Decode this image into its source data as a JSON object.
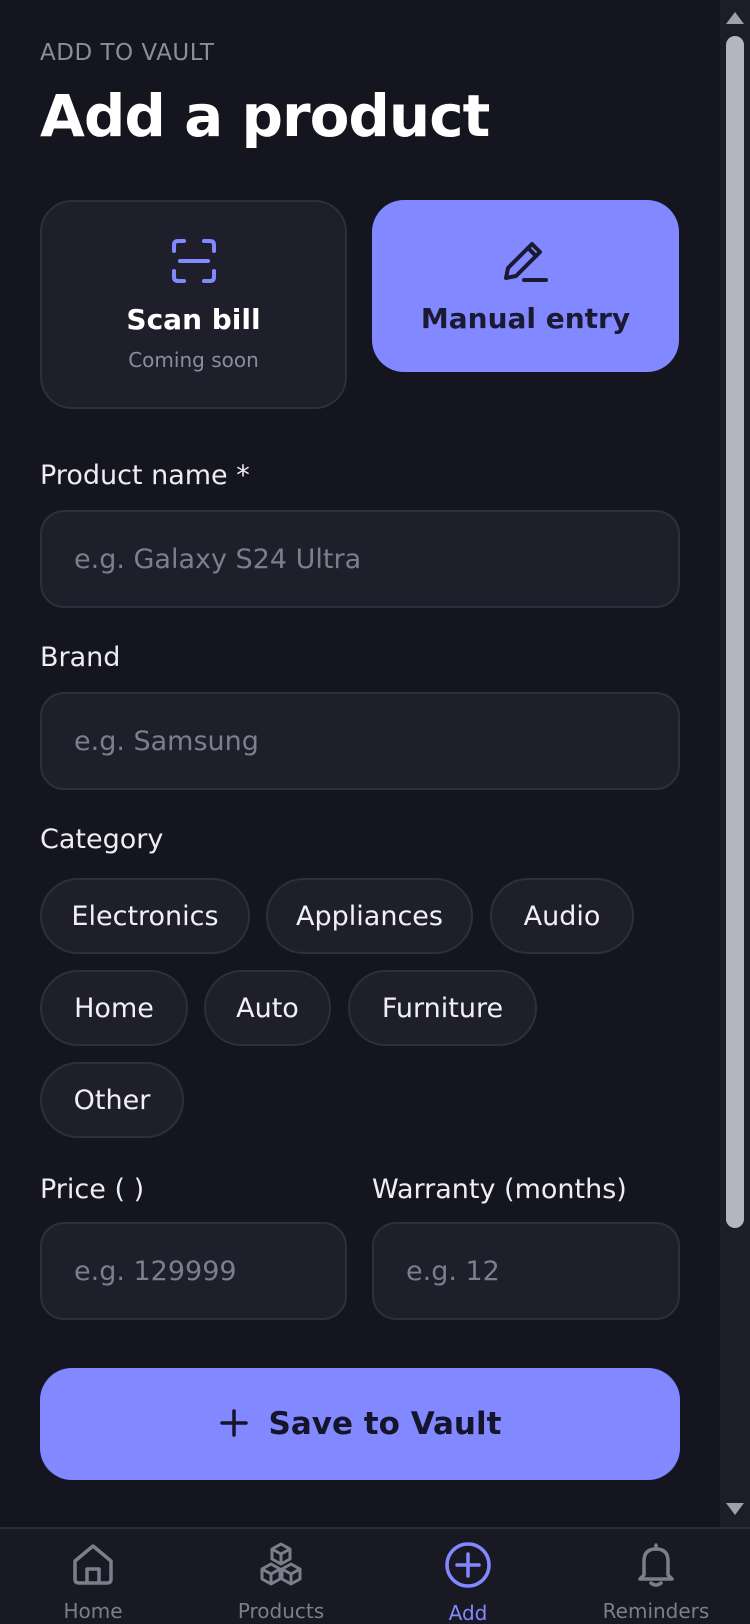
{
  "header": {
    "eyebrow": "ADD TO VAULT",
    "title": "Add a product"
  },
  "modes": {
    "scan": {
      "title": "Scan bill",
      "subtitle": "Coming soon",
      "icon": "scan-icon"
    },
    "manual": {
      "title": "Manual entry",
      "icon": "pencil-icon"
    }
  },
  "form": {
    "product_name": {
      "label": "Product name *",
      "placeholder": "e.g. Galaxy S24 Ultra"
    },
    "brand": {
      "label": "Brand",
      "placeholder": "e.g. Samsung"
    },
    "category": {
      "label": "Category",
      "options": [
        "Electronics",
        "Appliances",
        "Audio",
        "Home",
        "Auto",
        "Furniture",
        "Other"
      ]
    },
    "price": {
      "label": "Price (  )",
      "placeholder": "e.g. 129999"
    },
    "warranty": {
      "label": "Warranty (months)",
      "placeholder": "e.g. 12"
    }
  },
  "save_button": {
    "label": "Save to Vault",
    "icon": "plus-icon"
  },
  "nav": {
    "items": [
      {
        "label": "Home",
        "icon": "home-icon"
      },
      {
        "label": "Products",
        "icon": "cubes-icon"
      },
      {
        "label": "Add",
        "icon": "add-circle-icon"
      },
      {
        "label": "Reminders",
        "icon": "bell-icon"
      }
    ],
    "active": "Add"
  },
  "colors": {
    "background": "#15151f",
    "surface": "#1f1f2c",
    "accent": "#8288ff",
    "muted": "#8c8c9c"
  }
}
